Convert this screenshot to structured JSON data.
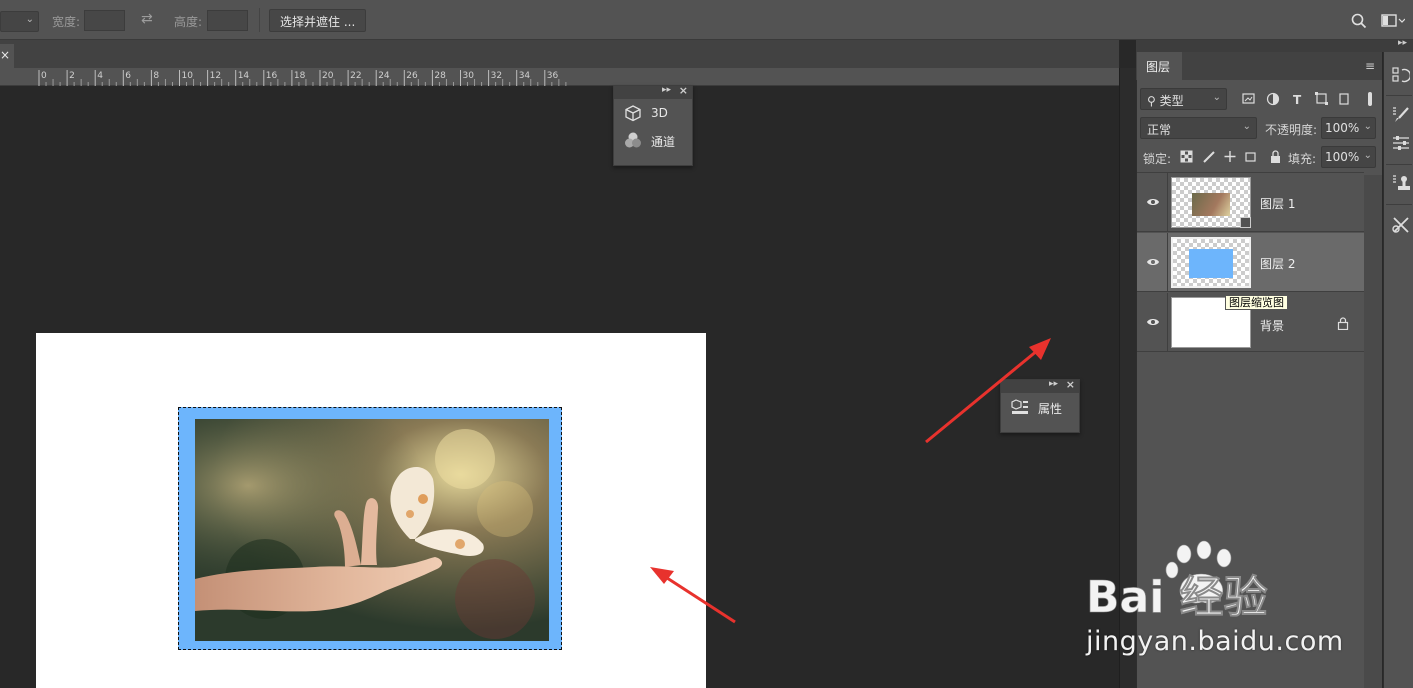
{
  "options_bar": {
    "width_label": "宽度:",
    "height_label": "高度:",
    "select_mask_button": "选择并遮住 ..."
  },
  "document_tab": {
    "close_glyph": "×"
  },
  "ruler": {
    "ticks": [
      "0",
      "2",
      "4",
      "6",
      "8",
      "10",
      "12",
      "14",
      "16",
      "18",
      "20",
      "22",
      "24",
      "26",
      "28",
      "30",
      "32",
      "34",
      "36"
    ]
  },
  "float_panel_top": {
    "items": [
      {
        "label": "3D",
        "icon": "cube-3d-icon"
      },
      {
        "label": "通道",
        "icon": "channels-icon"
      }
    ]
  },
  "float_panel_props": {
    "items": [
      {
        "label": "属性",
        "icon": "properties-icon"
      }
    ]
  },
  "layers_panel": {
    "tab_label": "图层",
    "filter_select": "类型",
    "blend_mode": "正常",
    "opacity_label": "不透明度:",
    "opacity_value": "100%",
    "lock_label": "锁定:",
    "fill_label": "填充:",
    "fill_value": "100%",
    "layers": [
      {
        "name": "图层 1",
        "visible": true,
        "selected": false
      },
      {
        "name": "图层 2",
        "visible": true,
        "selected": true
      },
      {
        "name": "背景",
        "visible": true,
        "selected": false,
        "locked": true
      }
    ],
    "tooltip": "图层缩览图"
  },
  "colors": {
    "accent_blue": "#6db5fc",
    "arrow_red": "#e8322d"
  },
  "watermark": {
    "logo_text": "Bai 经验",
    "url_text": "jingyan.baidu.com"
  }
}
